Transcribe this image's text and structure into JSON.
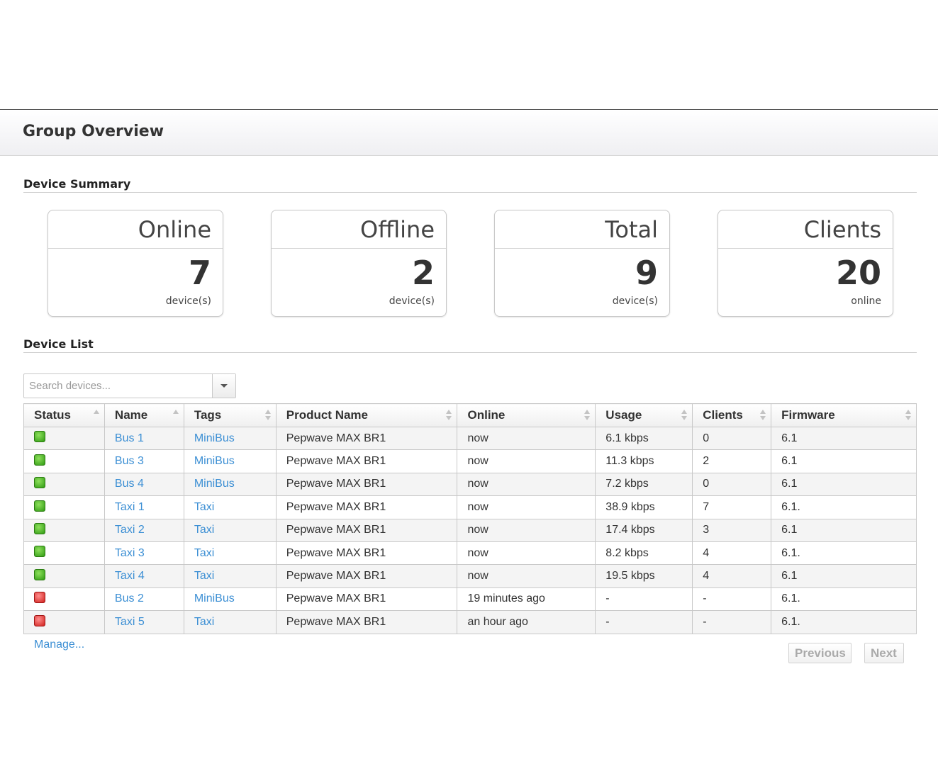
{
  "page": {
    "title": "Group Overview"
  },
  "summary": {
    "title": "Device Summary",
    "cards": [
      {
        "label": "Online",
        "value": "7",
        "unit": "device(s)"
      },
      {
        "label": "Offline",
        "value": "2",
        "unit": "device(s)"
      },
      {
        "label": "Total",
        "value": "9",
        "unit": "device(s)"
      },
      {
        "label": "Clients",
        "value": "20",
        "unit": "online"
      }
    ]
  },
  "device_list": {
    "title": "Device List",
    "search_placeholder": "Search devices...",
    "columns": [
      "Status",
      "Name",
      "Tags",
      "Product Name",
      "Online",
      "Usage",
      "Clients",
      "Firmware"
    ],
    "rows": [
      {
        "status": "online",
        "status_color": "#2f9a12",
        "name": "Bus 1",
        "tags": "MiniBus",
        "product": "Pepwave MAX BR1",
        "online": "now",
        "usage": "6.1 kbps",
        "clients": "0",
        "firmware": "6.1"
      },
      {
        "status": "online",
        "status_color": "#2f9a12",
        "name": "Bus 3",
        "tags": "MiniBus",
        "product": "Pepwave MAX BR1",
        "online": "now",
        "usage": "11.3 kbps",
        "clients": "2",
        "firmware": "6.1"
      },
      {
        "status": "online",
        "status_color": "#2f9a12",
        "name": "Bus 4",
        "tags": "MiniBus",
        "product": "Pepwave MAX BR1",
        "online": "now",
        "usage": "7.2 kbps",
        "clients": "0",
        "firmware": "6.1"
      },
      {
        "status": "online",
        "status_color": "#2f9a12",
        "name": "Taxi 1",
        "tags": "Taxi",
        "product": "Pepwave MAX BR1",
        "online": "now",
        "usage": "38.9 kbps",
        "clients": "7",
        "firmware": "6.1."
      },
      {
        "status": "online",
        "status_color": "#2f9a12",
        "name": "Taxi 2",
        "tags": "Taxi",
        "product": "Pepwave MAX BR1",
        "online": "now",
        "usage": "17.4 kbps",
        "clients": "3",
        "firmware": "6.1"
      },
      {
        "status": "online",
        "status_color": "#2f9a12",
        "name": "Taxi 3",
        "tags": "Taxi",
        "product": "Pepwave MAX BR1",
        "online": "now",
        "usage": "8.2 kbps",
        "clients": "4",
        "firmware": "6.1."
      },
      {
        "status": "online",
        "status_color": "#2f9a12",
        "name": "Taxi 4",
        "tags": "Taxi",
        "product": "Pepwave MAX BR1",
        "online": "now",
        "usage": "19.5 kbps",
        "clients": "4",
        "firmware": "6.1"
      },
      {
        "status": "offline",
        "status_color": "#d0201c",
        "name": "Bus 2",
        "tags": "MiniBus",
        "product": "Pepwave MAX BR1",
        "online": "19 minutes ago",
        "usage": "-",
        "clients": "-",
        "firmware": "6.1."
      },
      {
        "status": "offline",
        "status_color": "#d0201c",
        "name": "Taxi 5",
        "tags": "Taxi",
        "product": "Pepwave MAX BR1",
        "online": "an hour ago",
        "usage": "-",
        "clients": "-",
        "firmware": "6.1."
      }
    ],
    "manage_label": "Manage...",
    "previous_label": "Previous",
    "next_label": "Next"
  },
  "colors": {
    "link": "#3c8fd4",
    "online": "#2f9a12",
    "offline": "#d0201c"
  }
}
